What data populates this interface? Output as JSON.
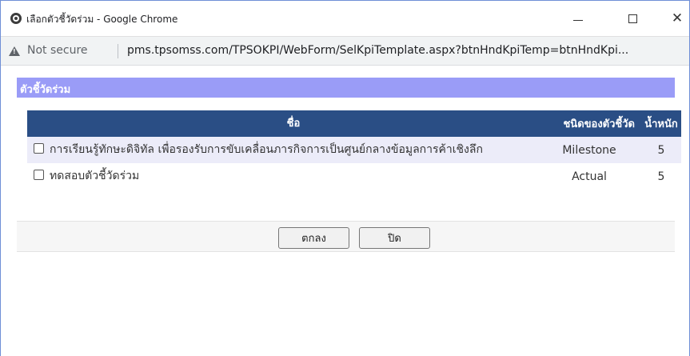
{
  "window": {
    "title": "เลือกตัวชี้วัดร่วม - Google Chrome",
    "controls": {
      "minimize": "—",
      "maximize": "☐",
      "close": "✕"
    }
  },
  "addressbar": {
    "security_label": "Not secure",
    "url": "pms.tpsomss.com/TPSOKPI/WebForm/SelKpiTemplate.aspx?btnHndKpiTemp=btnHndKpi..."
  },
  "panel": {
    "title": "ตัวชี้วัดร่วม"
  },
  "table": {
    "headers": {
      "name": "ชื่อ",
      "type": "ชนิดของตัวชี้วัด",
      "weight": "น้ำหนัก"
    },
    "rows": [
      {
        "checked": false,
        "name": "การเรียนรู้ทักษะดิจิทัล เพื่อรองรับการขับเคลื่อนภารกิจการเป็นศูนย์กลางข้อมูลการค้าเชิงลึก",
        "type": "Milestone",
        "weight": "5"
      },
      {
        "checked": false,
        "name": "ทดสอบตัวชี้วัดร่วม",
        "type": "Actual",
        "weight": "5"
      }
    ]
  },
  "buttons": {
    "ok": "ตกลง",
    "close": "ปิด"
  },
  "colors": {
    "panel_header": "#9a9cf7",
    "table_header": "#2a4e85",
    "row_alt": "#ececf9"
  }
}
